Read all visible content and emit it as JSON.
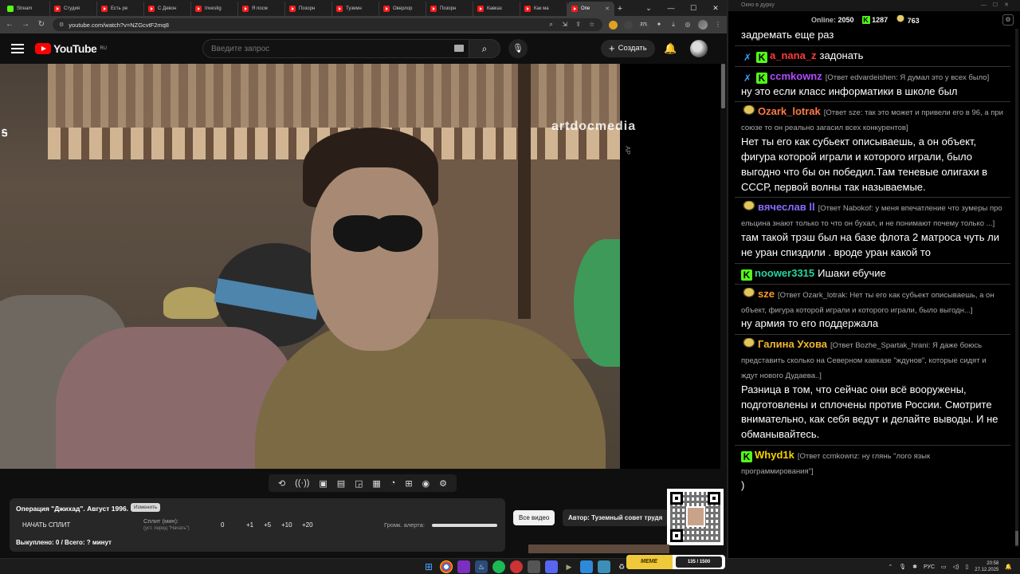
{
  "browser": {
    "tabs": [
      {
        "title": "Stream",
        "icon": "kick",
        "active": false
      },
      {
        "title": "Студия",
        "icon": "youtube",
        "active": false
      },
      {
        "title": "Есть ре",
        "icon": "youtube",
        "active": false
      },
      {
        "title": "С Девон",
        "icon": "youtube",
        "active": false
      },
      {
        "title": "Investig",
        "icon": "youtube",
        "active": false
      },
      {
        "title": "Я посм",
        "icon": "youtube",
        "active": false
      },
      {
        "title": "Позорн",
        "icon": "youtube",
        "active": false
      },
      {
        "title": "Туземн",
        "icon": "youtube",
        "active": false
      },
      {
        "title": "Оверлор",
        "icon": "youtube",
        "active": false
      },
      {
        "title": "Позорн",
        "icon": "youtube",
        "active": false
      },
      {
        "title": "Кавказ",
        "icon": "youtube",
        "active": false
      },
      {
        "title": "Как ма",
        "icon": "youtube",
        "active": false
      },
      {
        "title": "Опе",
        "icon": "youtube",
        "active": true
      }
    ],
    "url": "youtube.com/watch?v=NZGcvtF2mq8",
    "ext_badge": "271"
  },
  "youtube": {
    "logo_text": "YouTube",
    "region": "RU",
    "search_placeholder": "Введите запрос",
    "create_label": "Создать"
  },
  "video": {
    "watermark": "artdocmedia",
    "side_mark": "AP",
    "corner_mark": "Ꭶ"
  },
  "split": {
    "title": "Операция \"Джихад\". Август 1996.",
    "edit_label": "Изменить",
    "start_label": "НАЧАТЬ СПЛИТ",
    "split_label": "Сплит (мин):",
    "split_hint": "(уст. перед \"Начать\")",
    "split_value": "0",
    "increments": [
      "+1",
      "+5",
      "+10",
      "+20"
    ],
    "volume_label": "Громк. алерта:",
    "volume_level": 1.0,
    "bought_text": "Выкуплено: 0 / Всего: ? минут",
    "all_video_label": "Все видео",
    "author_text": "Автор: Туземный совет трудя"
  },
  "chat": {
    "window_title": "Окно в дурку",
    "online_label": "Online:",
    "online_count": "2050",
    "kick_count": "1287",
    "emote_count": "763",
    "colors": {
      "kick": "#53fc18",
      "sword": "#3aa0ff"
    },
    "messages": [
      {
        "badges": [],
        "user": "",
        "color": "#ffffff",
        "reply": "",
        "text": "задремать еще раз"
      },
      {
        "badges": [
          "sword",
          "kick"
        ],
        "user": "a_nana_z",
        "color": "#ff3b3b",
        "reply": "",
        "text": "задонать"
      },
      {
        "badges": [
          "sword",
          "kick"
        ],
        "user": "ccmkownz",
        "color": "#b04dff",
        "reply": "[Ответ edvardeishen: Я думал это у всех было]",
        "text": "ну это если класс информатики в школе был"
      },
      {
        "badges": [
          "emote"
        ],
        "user": "Ozark_lotrak",
        "color": "#ff7a45",
        "reply": "[Ответ sze: так это может и привели его в 96, а при союзе то он реально загасил всех конкурентов]",
        "text": "Нет ты его как субьект описываешь, а он объект, фигура которой играли и которого играли, было выгодно что бы он победил.Там теневые олигахи в СССР, первой волны так называемые."
      },
      {
        "badges": [
          "emote"
        ],
        "user": "вячеслав ll",
        "color": "#8a6bff",
        "reply": "[Ответ Nabokof: у меня впечатление что зумеры про ельцина знают только то что он бухал, и не понимают почему только ...]",
        "text": "там такой трэш был на базе флота 2 матроса чуть ли не уран спиздили . вроде уран какой то"
      },
      {
        "badges": [
          "kick"
        ],
        "user": "noower3315",
        "color": "#25d6a0",
        "reply": "",
        "text": "Ишаки ебучие"
      },
      {
        "badges": [
          "emote"
        ],
        "user": "sze",
        "color": "#ff9a2a",
        "reply": "[Ответ Ozark_lotrak: Нет ты его как субьект описываешь, а он объект, фигура которой играли и которого играли, было выгодн...]",
        "text": "ну армия то его поддержала"
      },
      {
        "badges": [
          "emote"
        ],
        "user": "Галина Ухова",
        "color": "#f2b631",
        "reply": "[Ответ Bozhe_Spartak_hrani: Я даже боюсь представить сколько на Северном кавказе \"ждунов\", которые сидят и ждут нового Дудаева..]",
        "text": "Разница в том, что сейчас они всё вооружены, подготовлены и сплочены против России. Смотрите внимательно, как себя ведут и делайте выводы. И не обманывайтесь."
      },
      {
        "badges": [
          "kick"
        ],
        "user": "Whyd1k",
        "color": "#f5d300",
        "reply": "[Ответ ccmkownz: ну глянь \"лого язык программирования\"]",
        "text": ")"
      }
    ]
  },
  "taskbar": {
    "meme_party": "MEME PARTY",
    "meme_count": "135 / 1500",
    "lang": "РУС",
    "time": "20:58",
    "date": "27.12.2025"
  }
}
